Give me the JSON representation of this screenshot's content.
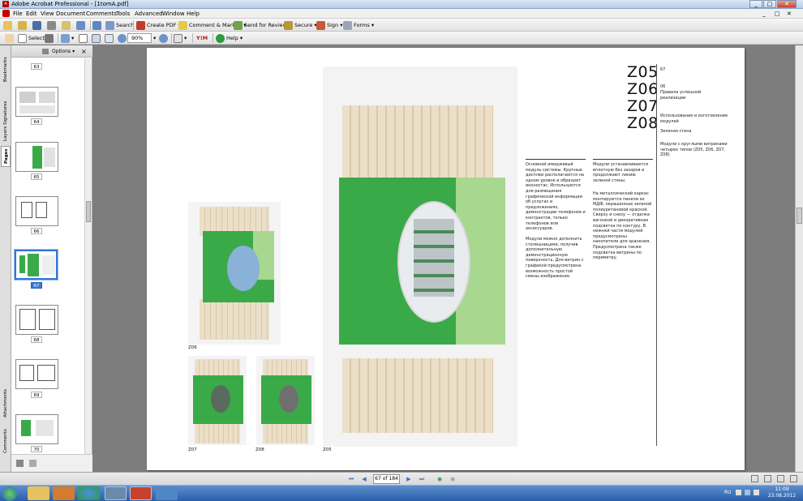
{
  "window": {
    "title": "Adobe Acrobat Professional - [1tomA.pdf]",
    "controls": [
      "_",
      "□",
      "✕"
    ]
  },
  "menu": [
    "File",
    "Edit",
    "View",
    "Document",
    "Comments",
    "Tools",
    "Advanced",
    "Window",
    "Help"
  ],
  "toolbar1": {
    "search": "Search",
    "create_pdf": "Create PDF",
    "comment": "Comment & Markup",
    "send_review": "Send for Review",
    "secure": "Secure",
    "sign": "Sign",
    "forms": "Forms"
  },
  "toolbar2": {
    "select": "Select",
    "zoom_value": "90%",
    "help": "Help",
    "yarn": "Y!M"
  },
  "nav_tabs": [
    "Bookmarks",
    "Signatures",
    "Layers",
    "Pages",
    "Attachments",
    "Comments"
  ],
  "panel": {
    "options": "Options",
    "close": "×"
  },
  "thumbnails": [
    {
      "label": "63"
    },
    {
      "label": "64"
    },
    {
      "label": "65"
    },
    {
      "label": "66"
    },
    {
      "label": "67",
      "selected": true
    },
    {
      "label": "68"
    },
    {
      "label": "69"
    },
    {
      "label": "70"
    }
  ],
  "page_content": {
    "codes": [
      "Z05",
      "Z06",
      "Z07",
      "Z08"
    ],
    "page_number": "67",
    "section_num": "06",
    "section_title": "Правила успешной реализации",
    "subsection": "Использование и изготовление модулей",
    "wall": "Зеленая стена",
    "modules_desc": "Модули с круглыми витринами четырех типов (Z05, Z06, Z07, Z08)",
    "col1": "Основной имиджевый модуль системы. Крупные дисплеи располагаются на одном уровне и образуют иконостас. Используются для размещения графической информации об услугах и предложениях, демонстрации телефонов и контрактов, только телефонов или аксессуаров.",
    "col1b": "Модули можно дополнить столешницами, получив дополнительную демонстрационную поверхность. Для витрин с графикой предусмотрена возможность простой смены изображения.",
    "col2": "Модули устанавливаются вплотную без зазоров и продолжают линию зеленой стены.",
    "col2b": "На металлический каркас монтируются панели из МДФ, окрашенные зеленой полиуретановой краской. Сверху и снизу — отделка вагонкой и декоративная подсветка по контуру. В нижней части модулей предусмотрены накопители для хранения. Предусмотрена также подсветка витрины по периметру.",
    "captions": {
      "z06": "Z06",
      "z07": "Z07",
      "z08": "Z08",
      "z05": "Z05"
    }
  },
  "status": {
    "page_field": "67 of 184"
  },
  "tray": {
    "lang": "RU",
    "time": "11:09",
    "date": "23.08.2012"
  },
  "colors": {
    "green": "#3aaa48",
    "light_green": "#a8d88f",
    "wood": "#e8dcc3",
    "accent_blue": "#3474d9"
  }
}
